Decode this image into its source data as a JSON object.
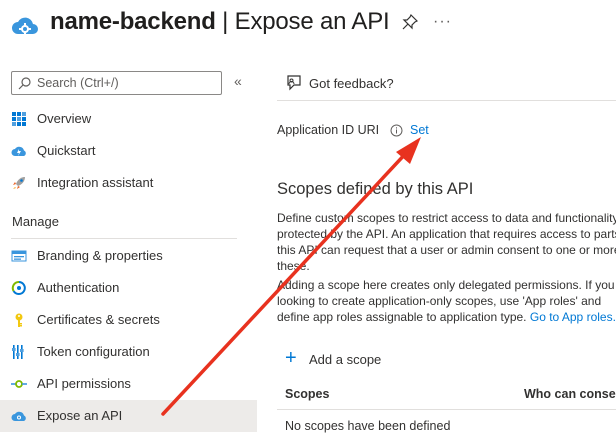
{
  "header": {
    "app_name": "name-backend",
    "separator": " | ",
    "page_title": "Expose an API",
    "more_label": "···"
  },
  "sidebar": {
    "search_placeholder": "Search (Ctrl+/)",
    "collapse_label": "«",
    "items_top": [
      {
        "label": "Overview",
        "icon": "overview-grid-icon"
      },
      {
        "label": "Quickstart",
        "icon": "quickstart-cloud-icon"
      },
      {
        "label": "Integration assistant",
        "icon": "rocket-icon"
      }
    ],
    "section_label": "Manage",
    "items_manage": [
      {
        "label": "Branding & properties",
        "icon": "branding-icon"
      },
      {
        "label": "Authentication",
        "icon": "authentication-icon"
      },
      {
        "label": "Certificates & secrets",
        "icon": "key-icon"
      },
      {
        "label": "Token configuration",
        "icon": "token-config-icon"
      },
      {
        "label": "API permissions",
        "icon": "api-permissions-icon"
      },
      {
        "label": "Expose an API",
        "icon": "expose-api-cloud-icon",
        "active": true
      }
    ]
  },
  "main": {
    "feedback_label": "Got feedback?",
    "app_id_label": "Application ID URI",
    "set_label": "Set",
    "scopes_title": "Scopes defined by this API",
    "para1": "Define custom scopes to restrict access to data and functionality protected by the API. An application that requires access to parts of this API can request that a user or admin consent to one or more of these.",
    "para2_text": "Adding a scope here creates only delegated permissions. If you are looking to create application-only scopes, use 'App roles' and define app roles assignable to application type.",
    "para2_link": "Go to App roles.",
    "add_scope_label": "Add a scope",
    "table": {
      "columns": [
        "Scopes",
        "Who can consent"
      ],
      "empty_text": "No scopes have been defined"
    }
  },
  "colors": {
    "accent": "#0078d4",
    "annotation_arrow": "#e8321f",
    "active_item_bg": "#edebe9"
  }
}
